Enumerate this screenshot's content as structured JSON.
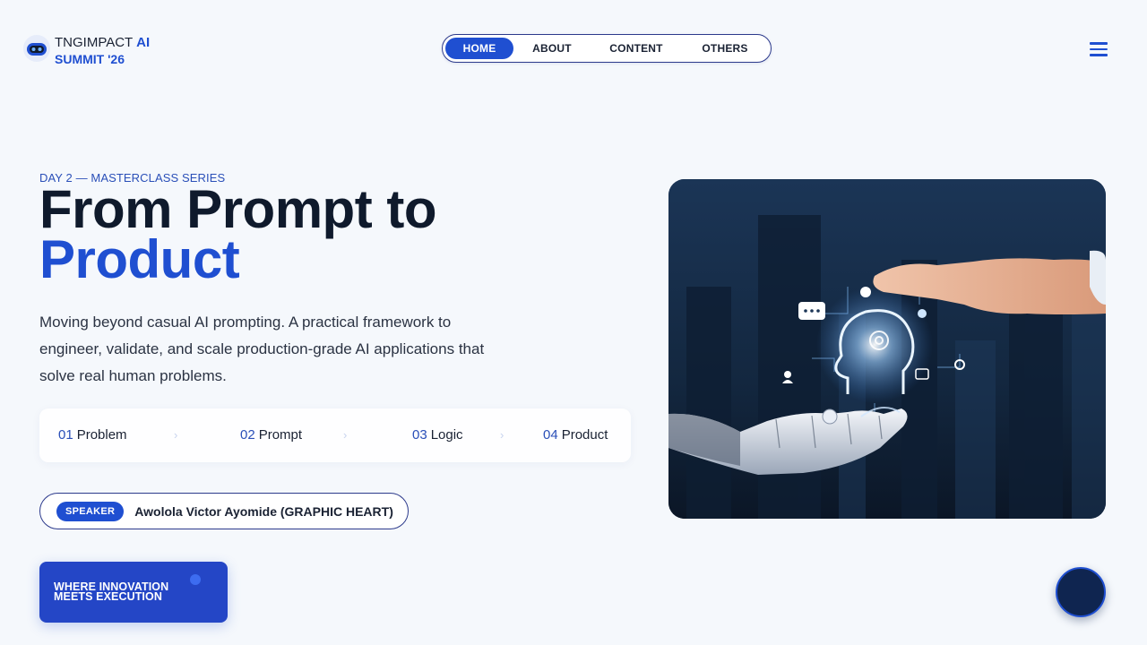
{
  "brand": {
    "name": "TNGIMPACT",
    "accent": "AI",
    "line2": "SUMMIT '26",
    "icon": "robot-logo-icon"
  },
  "nav": {
    "items": [
      {
        "label": "HOME",
        "active": true
      },
      {
        "label": "ABOUT",
        "active": false
      },
      {
        "label": "CONTENT",
        "active": false
      },
      {
        "label": "OTHERS",
        "active": false
      }
    ],
    "menu_icon": "hamburger-menu-icon"
  },
  "hero": {
    "eyebrow": "DAY 2 — MASTERCLASS SERIES",
    "headline_line1": "From Prompt to",
    "headline_line2": "Product",
    "description": "Moving beyond casual AI prompting. A practical framework to engineer, validate, and scale production-grade AI applications that solve real human problems.",
    "image_icon": "robot-hand-ai-head-image"
  },
  "steps": [
    {
      "num": "01",
      "label": "Problem"
    },
    {
      "num": "02",
      "label": "Prompt"
    },
    {
      "num": "03",
      "label": "Logic"
    },
    {
      "num": "04",
      "label": "Product"
    }
  ],
  "speaker": {
    "badge": "SPEAKER",
    "name": "Awolola Victor Ayomide (GRAPHIC HEART)"
  },
  "cta": {
    "line1": "WHERE INNOVATION",
    "line2": "MEETS EXECUTION"
  },
  "colors": {
    "accent": "#1f4fd1",
    "dark": "#0f1a2c",
    "background": "#f5f8fc"
  }
}
